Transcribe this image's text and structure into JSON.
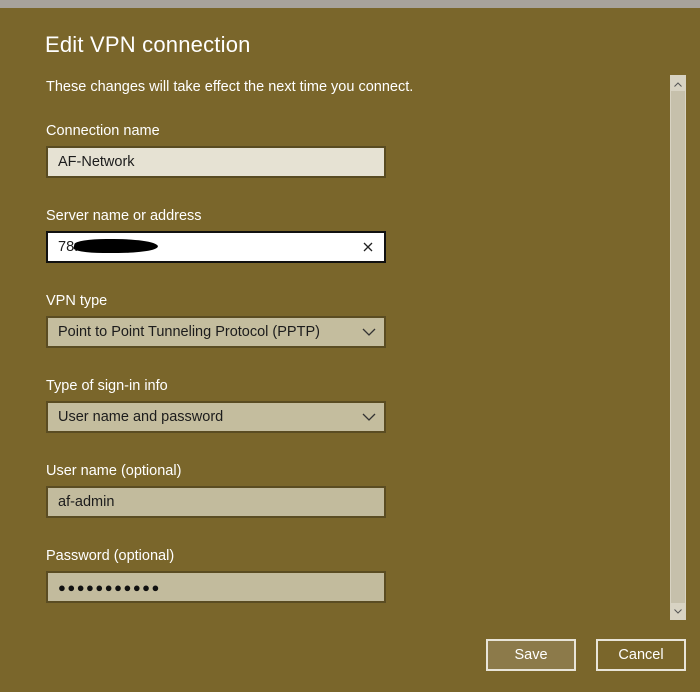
{
  "dialog": {
    "title": "Edit VPN connection",
    "subtitle": "These changes will take effect the next time you connect."
  },
  "fields": {
    "connection_name": {
      "label": "Connection name",
      "value": "AF-Network"
    },
    "server": {
      "label": "Server name or address",
      "value": "78.",
      "clear_icon": "close-icon"
    },
    "vpn_type": {
      "label": "VPN type",
      "value": "Point to Point Tunneling Protocol (PPTP)"
    },
    "sign_in_type": {
      "label": "Type of sign-in info",
      "value": "User name and password"
    },
    "username": {
      "label": "User name (optional)",
      "value": "af-admin"
    },
    "password": {
      "label": "Password (optional)",
      "value": "●●●●●●●●●●●"
    }
  },
  "buttons": {
    "save_label": "Save",
    "cancel_label": "Cancel"
  },
  "colors": {
    "accent_background": "#7a662b",
    "focused_field": "#ffffff"
  }
}
